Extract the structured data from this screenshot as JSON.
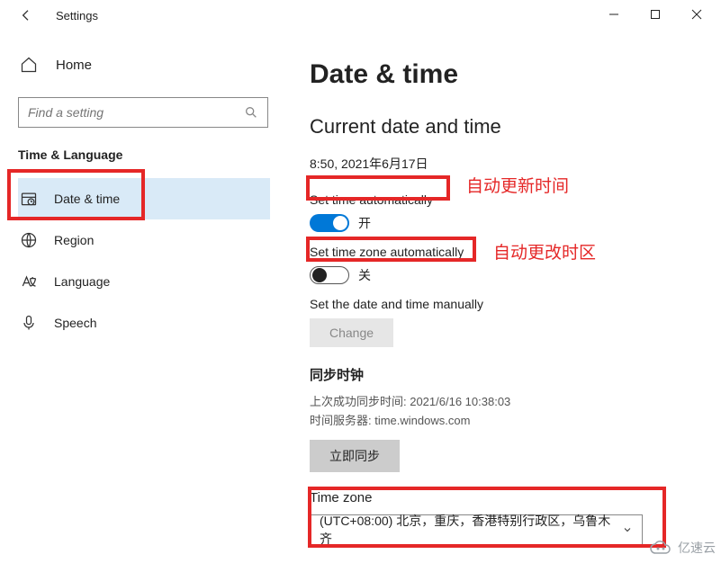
{
  "window": {
    "title": "Settings"
  },
  "sidebar": {
    "home_label": "Home",
    "search_placeholder": "Find a setting",
    "section_title": "Time & Language",
    "items": [
      {
        "icon": "clock-icon",
        "label": "Date & time",
        "active": true
      },
      {
        "icon": "globe-icon",
        "label": "Region",
        "active": false
      },
      {
        "icon": "language-icon",
        "label": "Language",
        "active": false
      },
      {
        "icon": "mic-icon",
        "label": "Speech",
        "active": false
      }
    ]
  },
  "content": {
    "page_title": "Date & time",
    "current_heading": "Current date and time",
    "current_value": "8:50, 2021年6月17日",
    "set_time_auto_label": "Set time automatically",
    "toggle_on_label": "开",
    "set_tz_auto_label": "Set time zone automatically",
    "toggle_off_label": "关",
    "manual_label": "Set the date and time manually",
    "change_label": "Change",
    "sync_header": "同步时钟",
    "sync_last": "上次成功同步时间: 2021/6/16 10:38:03",
    "sync_server": "时间服务器: time.windows.com",
    "sync_now_label": "立即同步",
    "tz_label": "Time zone",
    "tz_value": "(UTC+08:00) 北京，重庆，香港特别行政区，乌鲁木齐"
  },
  "annotations": {
    "auto_time": "自动更新时间",
    "auto_tz": "自动更改时区"
  },
  "watermark": "亿速云"
}
